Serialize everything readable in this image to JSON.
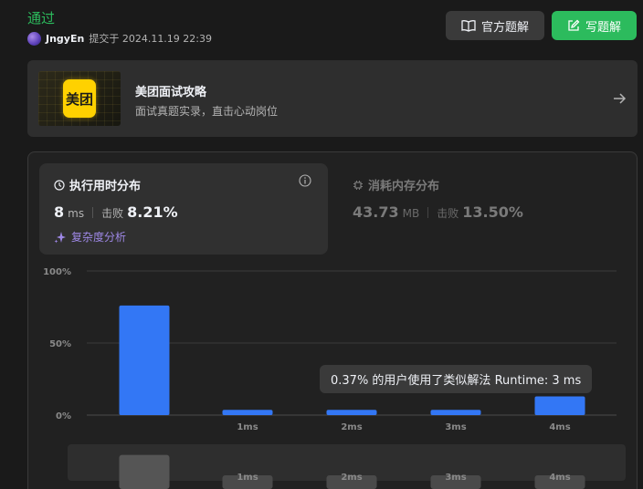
{
  "submission": {
    "status": "通过",
    "username": "JngyEn",
    "submitted_text": "提交于 2024.11.19 22:39"
  },
  "actions": {
    "official_label": "官方题解",
    "write_label": "写题解"
  },
  "banner": {
    "logo_text": "美团",
    "title": "美团面试攻略",
    "subtitle": "面试真题实录，直击心动岗位"
  },
  "runtime": {
    "title": "执行用时分布",
    "value": "8",
    "unit": "ms",
    "beats_label": "击败",
    "beats": "8.21%",
    "analysis_label": "复杂度分析"
  },
  "memory": {
    "title": "消耗内存分布",
    "value": "43.73",
    "unit": "MB",
    "beats_label": "击败",
    "beats": "13.50%"
  },
  "tooltip": "0.37% 的用户使用了类似解法 Runtime: 3 ms",
  "colors": {
    "accent_green": "#2cbb5d",
    "bar_blue": "#3377f5",
    "purple": "#9e88e6"
  },
  "chart_data": {
    "type": "bar",
    "y_tick_labels": [
      "100%",
      "50%",
      "0%"
    ],
    "ylim": [
      0,
      100
    ],
    "grid": true,
    "x_tick_labels": [
      "1ms",
      "2ms",
      "3ms",
      "4ms"
    ],
    "series": [
      {
        "values": [
          76,
          3.6,
          3.6,
          3.6,
          13
        ]
      }
    ],
    "brush": {
      "x_tick_labels": [
        "1ms",
        "2ms",
        "3ms",
        "4ms"
      ],
      "values": [
        76,
        3.6,
        3.6,
        3.6,
        13
      ]
    }
  }
}
